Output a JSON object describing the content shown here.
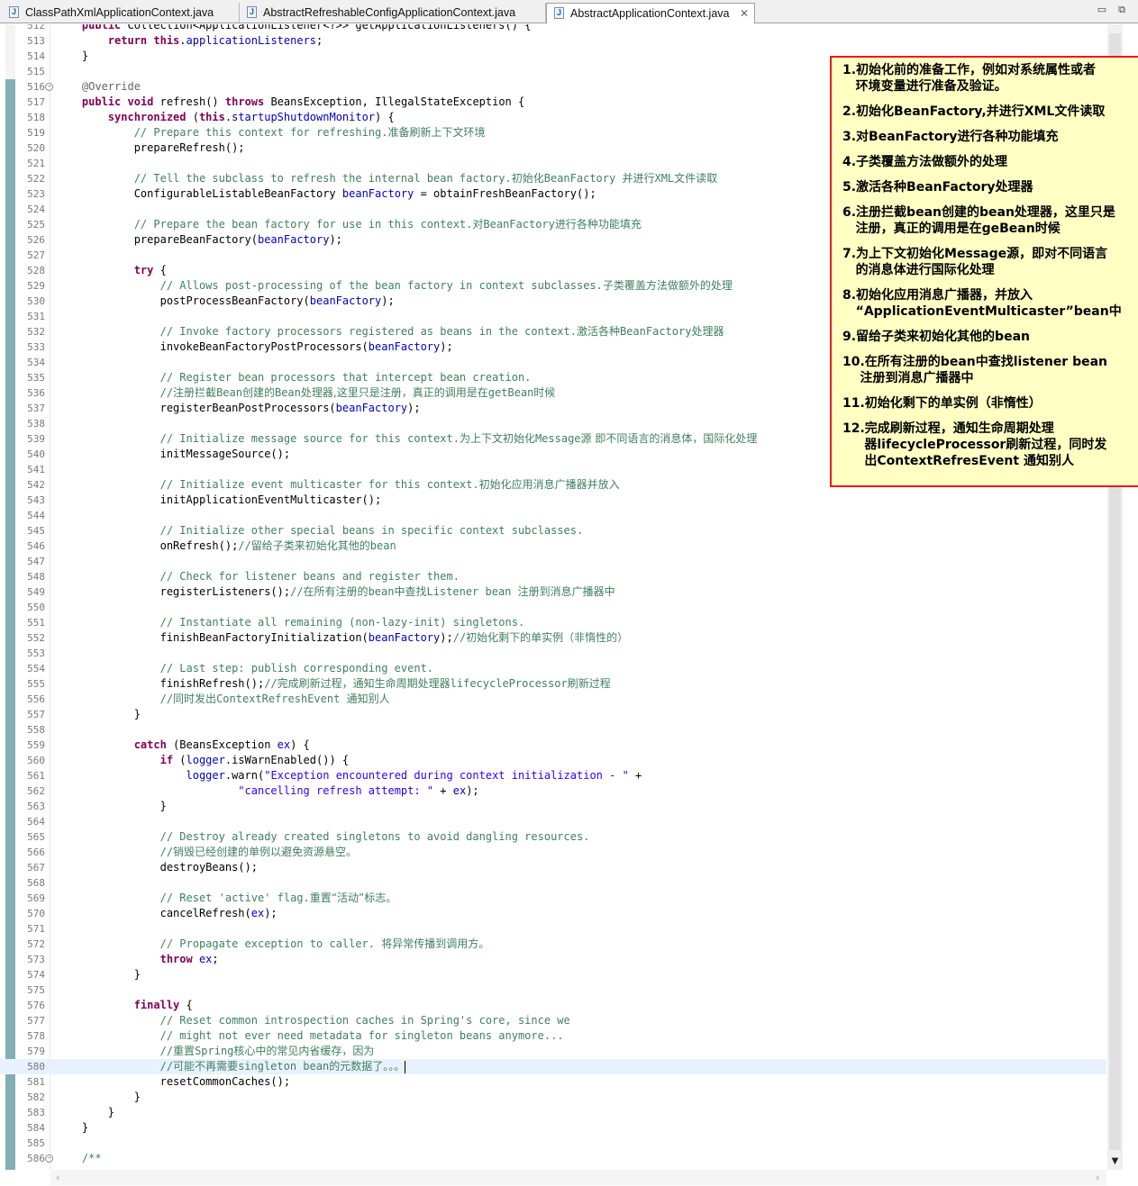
{
  "tabs": [
    {
      "label": "ClassPathXmlApplicationContext.java",
      "active": false
    },
    {
      "label": "AbstractRefreshableConfigApplicationContext.java",
      "active": false
    },
    {
      "label": "AbstractApplicationContext.java",
      "active": true
    }
  ],
  "window_controls": {
    "minimize": "▭",
    "maximize": "⧉"
  },
  "tab_close_glyph": "✕",
  "code_lines": [
    {
      "n": "512",
      "seg": [
        [
          "",
          "    "
        ],
        [
          "kw",
          "public"
        ],
        [
          "",
          " Collection<ApplicationListener<?>> getApplicationListeners() {"
        ]
      ]
    },
    {
      "n": "513",
      "seg": [
        [
          "",
          "        "
        ],
        [
          "kw",
          "return"
        ],
        [
          "",
          " "
        ],
        [
          "kw",
          "this"
        ],
        [
          "",
          "."
        ],
        [
          "fld",
          "applicationListeners"
        ],
        [
          "",
          ";"
        ]
      ]
    },
    {
      "n": "514",
      "seg": [
        [
          "",
          "    }"
        ]
      ]
    },
    {
      "n": "515",
      "seg": []
    },
    {
      "n": "516",
      "fold": true,
      "seg": [
        [
          "",
          "    "
        ],
        [
          "ann",
          "@Override"
        ]
      ]
    },
    {
      "n": "517",
      "seg": [
        [
          "",
          "    "
        ],
        [
          "kw",
          "public"
        ],
        [
          "",
          " "
        ],
        [
          "kw",
          "void"
        ],
        [
          "",
          " refresh() "
        ],
        [
          "kw",
          "throws"
        ],
        [
          "",
          " BeansException, IllegalStateException {"
        ]
      ]
    },
    {
      "n": "518",
      "seg": [
        [
          "",
          "        "
        ],
        [
          "kw",
          "synchronized"
        ],
        [
          "",
          " ("
        ],
        [
          "kw",
          "this"
        ],
        [
          "",
          "."
        ],
        [
          "fld",
          "startupShutdownMonitor"
        ],
        [
          "",
          ") {"
        ]
      ]
    },
    {
      "n": "519",
      "seg": [
        [
          "",
          "            "
        ],
        [
          "cm",
          "// Prepare this context for refreshing."
        ],
        [
          "cmcn",
          "准备刷新上下文环境"
        ]
      ]
    },
    {
      "n": "520",
      "seg": [
        [
          "",
          "            prepareRefresh();"
        ]
      ]
    },
    {
      "n": "521",
      "seg": []
    },
    {
      "n": "522",
      "seg": [
        [
          "",
          "            "
        ],
        [
          "cm",
          "// Tell the subclass to refresh the internal bean factory."
        ],
        [
          "cmcn",
          "初始化"
        ],
        [
          "cm",
          "BeanFactory "
        ],
        [
          "cmcn",
          "并进行"
        ],
        [
          "cm",
          "XML"
        ],
        [
          "cmcn",
          "文件读取"
        ]
      ]
    },
    {
      "n": "523",
      "seg": [
        [
          "",
          "            ConfigurableListableBeanFactory "
        ],
        [
          "fld",
          "beanFactory"
        ],
        [
          "",
          " = obtainFreshBeanFactory();"
        ]
      ]
    },
    {
      "n": "524",
      "seg": []
    },
    {
      "n": "525",
      "seg": [
        [
          "",
          "            "
        ],
        [
          "cm",
          "// Prepare the bean factory for use in this context."
        ],
        [
          "cmcn",
          "对"
        ],
        [
          "cm",
          "BeanFactory"
        ],
        [
          "cmcn",
          "进行各种功能填充"
        ]
      ]
    },
    {
      "n": "526",
      "seg": [
        [
          "",
          "            prepareBeanFactory("
        ],
        [
          "fld",
          "beanFactory"
        ],
        [
          "",
          ");"
        ]
      ]
    },
    {
      "n": "527",
      "seg": []
    },
    {
      "n": "528",
      "seg": [
        [
          "",
          "            "
        ],
        [
          "kw",
          "try"
        ],
        [
          "",
          " {"
        ]
      ]
    },
    {
      "n": "529",
      "seg": [
        [
          "",
          "                "
        ],
        [
          "cm",
          "// Allows post-processing of the bean factory in context subclasses."
        ],
        [
          "cmcn",
          "子类覆盖方法做额外的处理"
        ]
      ]
    },
    {
      "n": "530",
      "seg": [
        [
          "",
          "                postProcessBeanFactory("
        ],
        [
          "fld",
          "beanFactory"
        ],
        [
          "",
          ");"
        ]
      ]
    },
    {
      "n": "531",
      "seg": []
    },
    {
      "n": "532",
      "seg": [
        [
          "",
          "                "
        ],
        [
          "cm",
          "// Invoke factory processors registered as beans in the context."
        ],
        [
          "cmcn",
          "激活各种"
        ],
        [
          "cm",
          "BeanFactory"
        ],
        [
          "cmcn",
          "处理器"
        ]
      ]
    },
    {
      "n": "533",
      "seg": [
        [
          "",
          "                invokeBeanFactoryPostProcessors("
        ],
        [
          "fld",
          "beanFactory"
        ],
        [
          "",
          ");"
        ]
      ]
    },
    {
      "n": "534",
      "seg": []
    },
    {
      "n": "535",
      "seg": [
        [
          "",
          "                "
        ],
        [
          "cm",
          "// Register bean processors that intercept bean creation."
        ]
      ]
    },
    {
      "n": "536",
      "seg": [
        [
          "",
          "                "
        ],
        [
          "cm",
          "//"
        ],
        [
          "cmcn",
          "注册拦截"
        ],
        [
          "cm",
          "Bean"
        ],
        [
          "cmcn",
          "创建的"
        ],
        [
          "cm",
          "Bean"
        ],
        [
          "cmcn",
          "处理器,这里只是注册，真正的调用是在"
        ],
        [
          "cm",
          "getBean"
        ],
        [
          "cmcn",
          "时候"
        ]
      ]
    },
    {
      "n": "537",
      "seg": [
        [
          "",
          "                registerBeanPostProcessors("
        ],
        [
          "fld",
          "beanFactory"
        ],
        [
          "",
          ");"
        ]
      ]
    },
    {
      "n": "538",
      "seg": []
    },
    {
      "n": "539",
      "seg": [
        [
          "",
          "                "
        ],
        [
          "cm",
          "// Initialize message source for this context."
        ],
        [
          "cmcn",
          "为上下文初始化"
        ],
        [
          "cm",
          "Message"
        ],
        [
          "cmcn",
          "源 即不同语言的消息体，国际化处理"
        ]
      ]
    },
    {
      "n": "540",
      "seg": [
        [
          "",
          "                initMessageSource();"
        ]
      ]
    },
    {
      "n": "541",
      "seg": []
    },
    {
      "n": "542",
      "seg": [
        [
          "",
          "                "
        ],
        [
          "cm",
          "// Initialize event multicaster for this context."
        ],
        [
          "cmcn",
          "初始化应用消息广播器并放入"
        ]
      ]
    },
    {
      "n": "543",
      "seg": [
        [
          "",
          "                initApplicationEventMulticaster();"
        ]
      ]
    },
    {
      "n": "544",
      "seg": []
    },
    {
      "n": "545",
      "seg": [
        [
          "",
          "                "
        ],
        [
          "cm",
          "// Initialize other special beans in specific context subclasses."
        ]
      ]
    },
    {
      "n": "546",
      "seg": [
        [
          "",
          "                onRefresh();"
        ],
        [
          "cm",
          "//"
        ],
        [
          "cmcn",
          "留给子类来初始化其他的"
        ],
        [
          "cm",
          "bean"
        ]
      ]
    },
    {
      "n": "547",
      "seg": []
    },
    {
      "n": "548",
      "seg": [
        [
          "",
          "                "
        ],
        [
          "cm",
          "// Check for listener beans and register them."
        ]
      ]
    },
    {
      "n": "549",
      "seg": [
        [
          "",
          "                registerListeners();"
        ],
        [
          "cm",
          "//"
        ],
        [
          "cmcn",
          "在所有注册的"
        ],
        [
          "cm",
          "bean"
        ],
        [
          "cmcn",
          "中查找"
        ],
        [
          "cm",
          "Listener bean "
        ],
        [
          "cmcn",
          "注册到消息广播器中"
        ]
      ]
    },
    {
      "n": "550",
      "seg": []
    },
    {
      "n": "551",
      "seg": [
        [
          "",
          "                "
        ],
        [
          "cm",
          "// Instantiate all remaining (non-lazy-init) singletons."
        ]
      ]
    },
    {
      "n": "552",
      "seg": [
        [
          "",
          "                finishBeanFactoryInitialization("
        ],
        [
          "fld",
          "beanFactory"
        ],
        [
          "",
          ");"
        ],
        [
          "cm",
          "//"
        ],
        [
          "cmcn",
          "初始化剩下的单实例（非惰性的）"
        ]
      ]
    },
    {
      "n": "553",
      "seg": []
    },
    {
      "n": "554",
      "seg": [
        [
          "",
          "                "
        ],
        [
          "cm",
          "// Last step: publish corresponding event."
        ]
      ]
    },
    {
      "n": "555",
      "seg": [
        [
          "",
          "                finishRefresh();"
        ],
        [
          "cm",
          "//"
        ],
        [
          "cmcn",
          "完成刷新过程，通知生命周期处理器"
        ],
        [
          "cm",
          "lifecycleProcessor"
        ],
        [
          "cmcn",
          "刷新过程"
        ]
      ]
    },
    {
      "n": "556",
      "seg": [
        [
          "",
          "                "
        ],
        [
          "cm",
          "//"
        ],
        [
          "cmcn",
          "同时发出"
        ],
        [
          "cm",
          "ContextRefreshEvent "
        ],
        [
          "cmcn",
          "通知别人"
        ]
      ]
    },
    {
      "n": "557",
      "seg": [
        [
          "",
          "            }"
        ]
      ]
    },
    {
      "n": "558",
      "seg": []
    },
    {
      "n": "559",
      "seg": [
        [
          "",
          "            "
        ],
        [
          "kw",
          "catch"
        ],
        [
          "",
          " (BeansException "
        ],
        [
          "fld",
          "ex"
        ],
        [
          "",
          ") {"
        ]
      ]
    },
    {
      "n": "560",
      "seg": [
        [
          "",
          "                "
        ],
        [
          "kw",
          "if"
        ],
        [
          "",
          " ("
        ],
        [
          "fld",
          "logger"
        ],
        [
          "",
          ".isWarnEnabled()) {"
        ]
      ]
    },
    {
      "n": "561",
      "seg": [
        [
          "",
          "                    "
        ],
        [
          "fld",
          "logger"
        ],
        [
          "",
          ".warn("
        ],
        [
          "str",
          "\"Exception encountered during context initialization - \""
        ],
        [
          "",
          " +"
        ]
      ]
    },
    {
      "n": "562",
      "seg": [
        [
          "",
          "                            "
        ],
        [
          "str",
          "\"cancelling refresh attempt: \""
        ],
        [
          "",
          " + "
        ],
        [
          "fld",
          "ex"
        ],
        [
          "",
          ");"
        ]
      ]
    },
    {
      "n": "563",
      "seg": [
        [
          "",
          "                }"
        ]
      ]
    },
    {
      "n": "564",
      "seg": []
    },
    {
      "n": "565",
      "seg": [
        [
          "",
          "                "
        ],
        [
          "cm",
          "// Destroy already created singletons to avoid dangling resources."
        ]
      ]
    },
    {
      "n": "566",
      "seg": [
        [
          "",
          "                "
        ],
        [
          "cm",
          "//"
        ],
        [
          "cmcn",
          "销毁已经创建的单例以避免资源悬空。"
        ]
      ]
    },
    {
      "n": "567",
      "seg": [
        [
          "",
          "                destroyBeans();"
        ]
      ]
    },
    {
      "n": "568",
      "seg": []
    },
    {
      "n": "569",
      "seg": [
        [
          "",
          "                "
        ],
        [
          "cm",
          "// Reset 'active' flag."
        ],
        [
          "cmcn",
          "重置“活动”标志。"
        ]
      ]
    },
    {
      "n": "570",
      "seg": [
        [
          "",
          "                cancelRefresh("
        ],
        [
          "fld",
          "ex"
        ],
        [
          "",
          ");"
        ]
      ]
    },
    {
      "n": "571",
      "seg": []
    },
    {
      "n": "572",
      "seg": [
        [
          "",
          "                "
        ],
        [
          "cm",
          "// Propagate exception to caller. "
        ],
        [
          "cmcn",
          "将异常传播到调用方。"
        ]
      ]
    },
    {
      "n": "573",
      "seg": [
        [
          "",
          "                "
        ],
        [
          "kw",
          "throw"
        ],
        [
          "",
          " "
        ],
        [
          "fld",
          "ex"
        ],
        [
          "",
          ";"
        ]
      ]
    },
    {
      "n": "574",
      "seg": [
        [
          "",
          "            }"
        ]
      ]
    },
    {
      "n": "575",
      "seg": []
    },
    {
      "n": "576",
      "seg": [
        [
          "",
          "            "
        ],
        [
          "kw",
          "finally"
        ],
        [
          "",
          " {"
        ]
      ]
    },
    {
      "n": "577",
      "seg": [
        [
          "",
          "                "
        ],
        [
          "cm",
          "// Reset common introspection caches in Spring's core, since we"
        ]
      ]
    },
    {
      "n": "578",
      "seg": [
        [
          "",
          "                "
        ],
        [
          "cm",
          "// might not ever need metadata for singleton beans anymore..."
        ]
      ]
    },
    {
      "n": "579",
      "seg": [
        [
          "",
          "                "
        ],
        [
          "cm",
          "//"
        ],
        [
          "cmcn",
          "重置"
        ],
        [
          "cm",
          "Spring"
        ],
        [
          "cmcn",
          "核心中的常见内省缓存，因为"
        ]
      ]
    },
    {
      "n": "580",
      "cur": true,
      "seg": [
        [
          "",
          "                "
        ],
        [
          "cm",
          "//"
        ],
        [
          "cmcn",
          "可能不再需要"
        ],
        [
          "cm",
          "singleton bean"
        ],
        [
          "cmcn",
          "的元数据了。。。"
        ]
      ]
    },
    {
      "n": "581",
      "seg": [
        [
          "",
          "                resetCommonCaches();"
        ]
      ]
    },
    {
      "n": "582",
      "seg": [
        [
          "",
          "            }"
        ]
      ]
    },
    {
      "n": "583",
      "seg": [
        [
          "",
          "        }"
        ]
      ]
    },
    {
      "n": "584",
      "seg": [
        [
          "",
          "    }"
        ]
      ]
    },
    {
      "n": "585",
      "seg": []
    },
    {
      "n": "586",
      "fold": true,
      "seg": [
        [
          "",
          "    "
        ],
        [
          "cm",
          "/**"
        ]
      ]
    }
  ],
  "notes": [
    "1.初始化前的准备工作，例如对系统属性或者\n   环境变量进行准备及验证。",
    "2.初始化BeanFactory,并进行XML文件读取",
    "3.对BeanFactory进行各种功能填充",
    "4.子类覆盖方法做额外的处理",
    "5.激活各种BeanFactory处理器",
    "6.注册拦截bean创建的bean处理器，这里只是\n   注册，真正的调用是在geBean时候",
    "7.为上下文初始化Message源，即对不同语言\n   的消息体进行国际化处理",
    "8.初始化应用消息广播器，并放入\n   “ApplicationEventMulticaster”bean中",
    "9.留给子类来初始化其他的bean",
    "10.在所有注册的bean中查找listener bean\n    注册到消息广播器中",
    "11.初始化剩下的单实例（非惰性）",
    "12.完成刷新过程，通知生命周期处理\n     器lifecycleProcessor刷新过程，同时发\n     出ContextRefresEvent 通知别人"
  ],
  "colors": {
    "keyword": "#7f0055",
    "comment": "#3f7f5f",
    "field": "#0000c0",
    "string": "#2a00ff",
    "note_border": "#e81a1a",
    "note_bg": "#ffffc4"
  }
}
